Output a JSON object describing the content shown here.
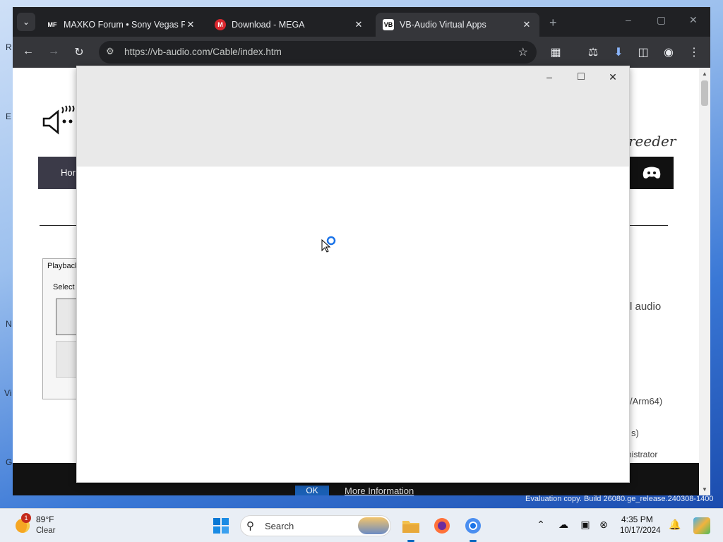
{
  "browser": {
    "tabs": [
      {
        "favicon": "MF",
        "title": "MAXKO Forum • Sony Vegas P",
        "close": "✕"
      },
      {
        "favicon": "M",
        "title": "Download - MEGA",
        "close": "✕"
      },
      {
        "favicon": "VB",
        "title": "VB-Audio Virtual Apps",
        "close": "✕"
      }
    ],
    "new_tab": "+",
    "url": "https://vb-audio.com/Cable/index.htm",
    "window_controls": {
      "minimize": "–",
      "maximize": "▢",
      "close": "✕"
    }
  },
  "page": {
    "signature": "reeder",
    "nav_home": "Hor",
    "playback_tab": "Playback",
    "select_label": "Select",
    "text_audio": "l audio",
    "text_arm": "/Arm64)",
    "text_paren": "s)",
    "text_admin": "nistrator",
    "ok_button": "OK",
    "more_info": "More Information"
  },
  "dialog": {
    "controls": {
      "minimize": "–",
      "maximize": "□",
      "close": "✕"
    }
  },
  "desktop": {
    "watermark": "Evaluation copy. Build 26080.ge_release.240308-1400"
  },
  "taskbar": {
    "weather": {
      "badge": "1",
      "temp": "89°F",
      "condition": "Clear"
    },
    "search_label": "Search",
    "clock": {
      "time": "4:35 PM",
      "date": "10/17/2024"
    }
  },
  "colors": {
    "tab_bg": "#202124",
    "toolbar_bg": "#35363a",
    "accent": "#0067c0"
  }
}
